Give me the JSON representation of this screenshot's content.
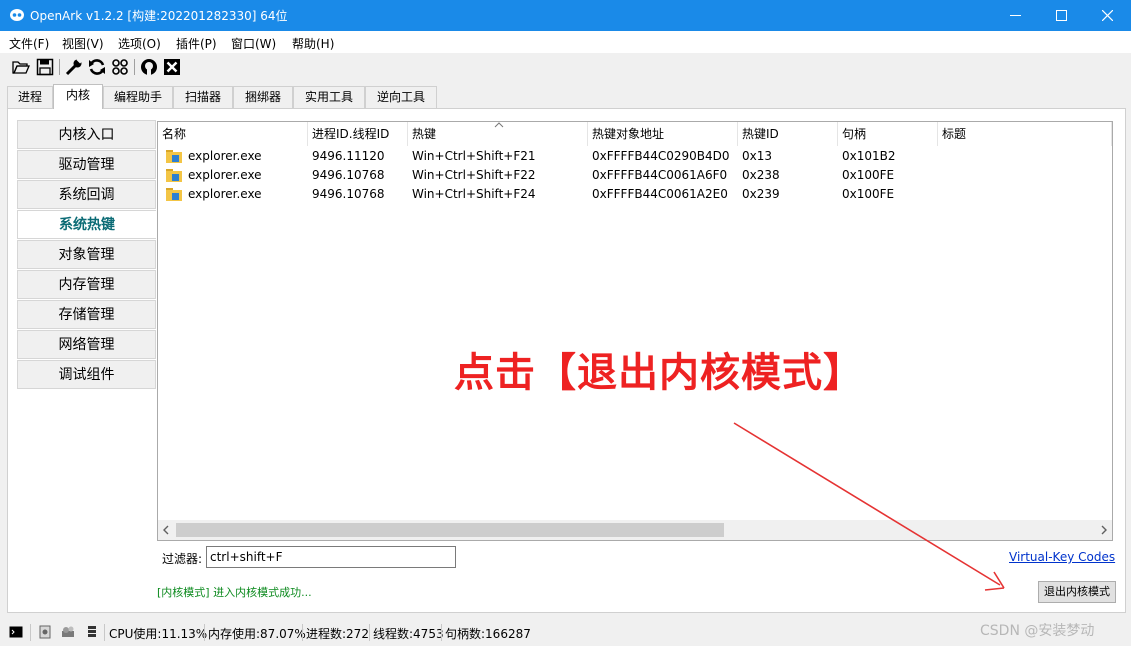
{
  "window": {
    "title": "OpenArk v1.2.2  [构建:202201282330]  64位",
    "accent": "#1a8ae8"
  },
  "menu": [
    "文件(F)",
    "视图(V)",
    "选项(O)",
    "插件(P)",
    "窗口(W)",
    "帮助(H)"
  ],
  "toolbar_icons": [
    "folder-open-icon",
    "save-icon",
    "wrench-icon",
    "refresh-icon",
    "grid-icon",
    "github-icon",
    "close-box-icon"
  ],
  "tabs": [
    "进程",
    "内核",
    "编程助手",
    "扫描器",
    "捆绑器",
    "实用工具",
    "逆向工具"
  ],
  "active_tab": "内核",
  "sidebar": [
    "内核入口",
    "驱动管理",
    "系统回调",
    "系统热键",
    "对象管理",
    "内存管理",
    "存储管理",
    "网络管理",
    "调试组件"
  ],
  "active_sidebar": "系统热键",
  "table": {
    "columns": [
      "名称",
      "进程ID.线程ID",
      "热键",
      "热键对象地址",
      "热键ID",
      "句柄",
      "标题"
    ],
    "rows": [
      [
        "explorer.exe",
        "9496.11120",
        "Win+Ctrl+Shift+F21",
        "0xFFFFB44C0290B4D0",
        "0x13",
        "0x101B2",
        ""
      ],
      [
        "explorer.exe",
        "9496.10768",
        "Win+Ctrl+Shift+F22",
        "0xFFFFB44C0061A6F0",
        "0x238",
        "0x100FE",
        ""
      ],
      [
        "explorer.exe",
        "9496.10768",
        "Win+Ctrl+Shift+F24",
        "0xFFFFB44C0061A2E0",
        "0x239",
        "0x100FE",
        ""
      ]
    ]
  },
  "filter": {
    "label": "过滤器:",
    "value": "ctrl+shift+F"
  },
  "vk_link": "Virtual-Key Codes",
  "log": "[内核模式] 进入内核模式成功...",
  "exit_button": "退出内核模式",
  "annotation": "点击【退出内核模式】",
  "annotation_color": "#ee2222",
  "status": {
    "cpu": "CPU使用:11.13%",
    "mem": "内存使用:87.07%",
    "procs": "进程数:272",
    "threads": "线程数:4753",
    "handles": "句柄数:166287"
  },
  "watermark": "CSDN @安装梦动"
}
